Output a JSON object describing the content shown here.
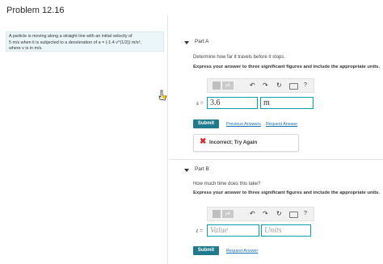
{
  "problem": {
    "title": "Problem 12.16",
    "text_line1": "A particle is moving along a straight line with an initial velocity of",
    "text_line2": "5 m/s when it is subjected to a deceleration of a = (-1.4 v^(1/2)) m/s²,",
    "text_line3": "where v is in m/s."
  },
  "partA": {
    "label": "Part A",
    "question": "Determine how far it travels before it stops.",
    "instruction": "Express your answer to three significant figures and include the appropriate units.",
    "toolbar_units_label": "μA",
    "var_label": "s =",
    "value": "3.6",
    "units": "m",
    "submit_label": "Submit",
    "prev_answers_label": "Previous Answers",
    "request_answer_label": "Request Answer",
    "feedback": "Incorrect; Try Again"
  },
  "partB": {
    "label": "Part B",
    "question": "How much time does this take?",
    "instruction": "Express your answer to three significant figures and include the appropriate units.",
    "toolbar_units_label": "μA",
    "var_label": "t =",
    "value_placeholder": "Value",
    "units_placeholder": "Units",
    "submit_label": "Submit",
    "request_answer_label": "Request Answer"
  },
  "colors": {
    "accent": "#1f7a8c",
    "input_border": "#0ba0a8",
    "link": "#1a6fb5",
    "error": "#cc2b2b"
  }
}
